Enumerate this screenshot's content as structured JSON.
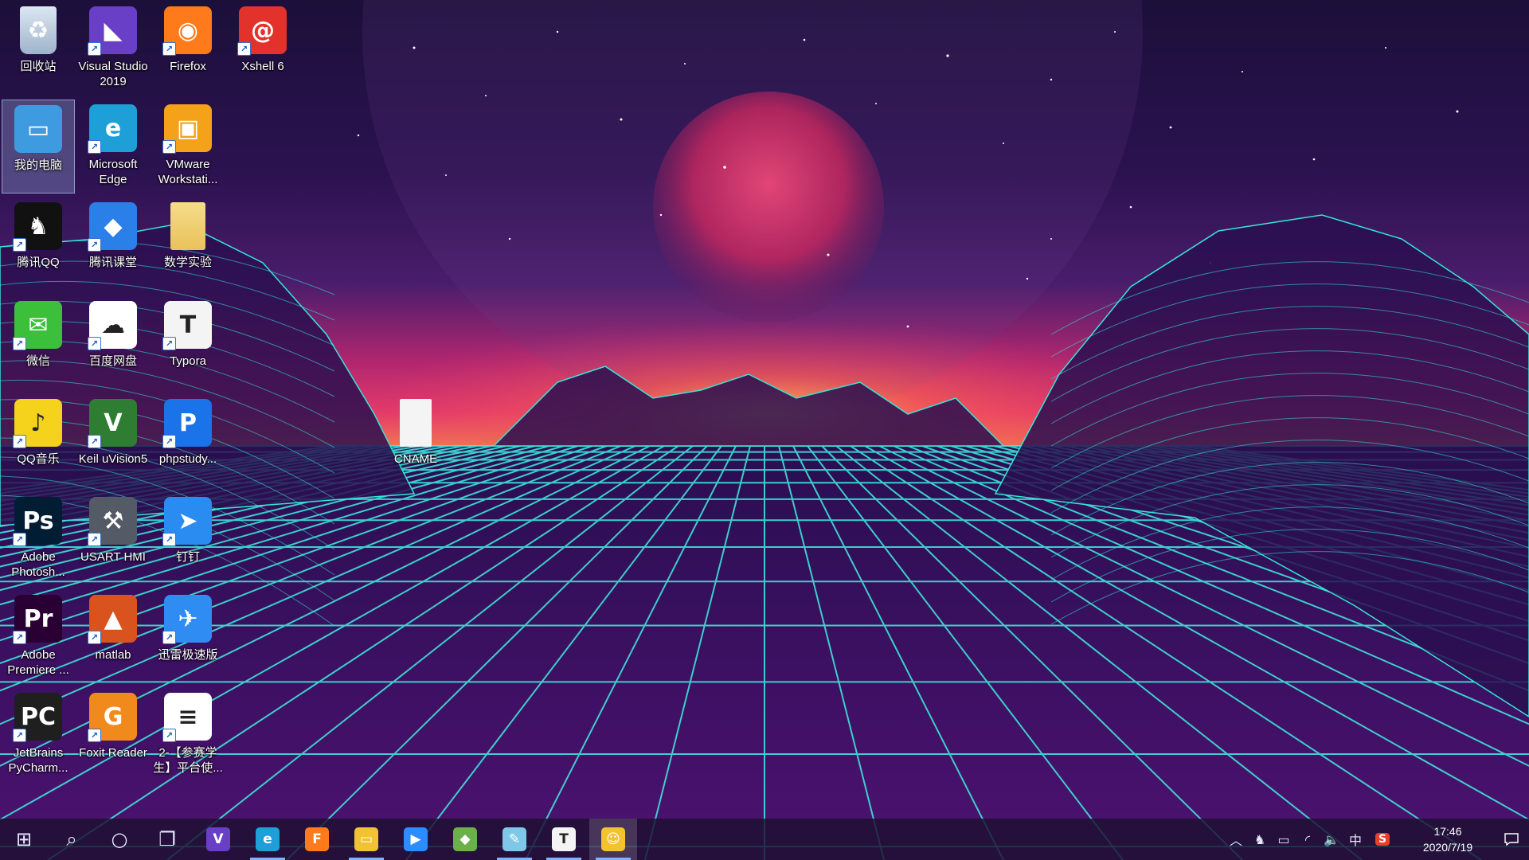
{
  "desktop_icons": [
    {
      "id": "recycle",
      "label": "回收站",
      "icon": "recycle-bin-icon",
      "color": "#8fa8c8",
      "shortcut": false
    },
    {
      "id": "visual_studio",
      "label": "Visual Studio 2019",
      "icon": "visual-studio-icon",
      "color": "#6a3fc8",
      "shortcut": true
    },
    {
      "id": "firefox",
      "label": "Firefox",
      "icon": "firefox-icon",
      "color": "#ff7a1a",
      "shortcut": true
    },
    {
      "id": "xshell",
      "label": "Xshell 6",
      "icon": "xshell-icon",
      "color": "#e2322b",
      "shortcut": true
    },
    {
      "id": "my_computer",
      "label": "我的电脑",
      "icon": "computer-icon",
      "color": "#3f9be0",
      "shortcut": false
    },
    {
      "id": "edge",
      "label": "Microsoft Edge",
      "icon": "edge-icon",
      "color": "#1e9fd8",
      "shortcut": true
    },
    {
      "id": "vmware",
      "label": "VMware Workstati...",
      "icon": "vmware-icon",
      "color": "#f3a21a",
      "shortcut": true
    },
    {
      "id": "qq",
      "label": "腾讯QQ",
      "icon": "qq-penguin-icon",
      "color": "#111111",
      "shortcut": true
    },
    {
      "id": "tencent_class",
      "label": "腾讯课堂",
      "icon": "tencent-classroom-icon",
      "color": "#2b7fe8",
      "shortcut": true
    },
    {
      "id": "math_lab",
      "label": "数学实验",
      "icon": "folder-icon",
      "color": "#f1d27a",
      "shortcut": false
    },
    {
      "id": "wechat",
      "label": "微信",
      "icon": "wechat-icon",
      "color": "#3cc03c",
      "shortcut": true
    },
    {
      "id": "baidu_pan",
      "label": "百度网盘",
      "icon": "baidu-netdisk-icon",
      "color": "#ffffff",
      "shortcut": true
    },
    {
      "id": "typora",
      "label": "Typora",
      "icon": "typora-icon",
      "color": "#f4f4f4",
      "shortcut": true
    },
    {
      "id": "qq_music",
      "label": "QQ音乐",
      "icon": "qq-music-icon",
      "color": "#f5d21c",
      "shortcut": true
    },
    {
      "id": "keil",
      "label": "Keil uVision5",
      "icon": "keil-icon",
      "color": "#2e7d32",
      "shortcut": true
    },
    {
      "id": "phpstudy",
      "label": "phpstudy...",
      "icon": "phpstudy-icon",
      "color": "#1a73e8",
      "shortcut": true
    },
    {
      "id": "cname",
      "label": "CNAME",
      "icon": "file-icon",
      "color": "#ffffff",
      "shortcut": false
    },
    {
      "id": "photoshop",
      "label": "Adobe Photosh...",
      "icon": "photoshop-icon",
      "color": "#001d34",
      "shortcut": true
    },
    {
      "id": "usart_hmi",
      "label": "USART HMI",
      "icon": "usart-hmi-icon",
      "color": "#555b66",
      "shortcut": true
    },
    {
      "id": "dingtalk",
      "label": "钉钉",
      "icon": "dingtalk-icon",
      "color": "#2a8cf0",
      "shortcut": true
    },
    {
      "id": "premiere",
      "label": "Adobe Premiere ...",
      "icon": "premiere-icon",
      "color": "#2a0034",
      "shortcut": true
    },
    {
      "id": "matlab",
      "label": "matlab",
      "icon": "matlab-icon",
      "color": "#d9531e",
      "shortcut": true
    },
    {
      "id": "xunlei",
      "label": "迅雷极速版",
      "icon": "xunlei-icon",
      "color": "#2f8cf2",
      "shortcut": true
    },
    {
      "id": "pycharm",
      "label": "JetBrains PyCharm...",
      "icon": "pycharm-icon",
      "color": "#1f1f1f",
      "shortcut": true
    },
    {
      "id": "foxit",
      "label": "Foxit Reader",
      "icon": "foxit-reader-icon",
      "color": "#f08a1c",
      "shortcut": true
    },
    {
      "id": "doc_2",
      "label": "2-【参赛学生】平台使...",
      "icon": "document-thumbnail-icon",
      "color": "#ffffff",
      "shortcut": true
    }
  ],
  "taskbar": {
    "items": [
      {
        "name": "start-button",
        "icon": "windows-logo-icon",
        "glyph": "⊞",
        "running": false,
        "active": false
      },
      {
        "name": "search-button",
        "icon": "search-icon",
        "glyph": "⌕",
        "running": false,
        "active": false
      },
      {
        "name": "cortana-button",
        "icon": "cortana-circle-icon",
        "glyph": "○",
        "running": false,
        "active": false
      },
      {
        "name": "task-view-button",
        "icon": "task-view-icon",
        "glyph": "❐",
        "running": false,
        "active": false
      },
      {
        "name": "taskbar-visual-studio",
        "icon": "visual-studio-icon",
        "glyph": "V",
        "color": "#6a3fc8",
        "running": false,
        "active": false
      },
      {
        "name": "taskbar-edge",
        "icon": "edge-icon",
        "glyph": "e",
        "color": "#1e9fd8",
        "running": true,
        "active": false
      },
      {
        "name": "taskbar-firefox",
        "icon": "firefox-icon",
        "glyph": "F",
        "color": "#ff7a1a",
        "running": false,
        "active": false
      },
      {
        "name": "taskbar-file-explorer",
        "icon": "folder-icon",
        "glyph": "▭",
        "color": "#f1c232",
        "running": true,
        "active": false
      },
      {
        "name": "taskbar-zoom",
        "icon": "video-camera-icon",
        "glyph": "▶",
        "color": "#2d8cff",
        "running": false,
        "active": false
      },
      {
        "name": "taskbar-git",
        "icon": "git-diamond-icon",
        "glyph": "◆",
        "color": "#6bb04a",
        "running": false,
        "active": false
      },
      {
        "name": "taskbar-notepad",
        "icon": "notepad-icon",
        "glyph": "✎",
        "color": "#7fc7e8",
        "running": true,
        "active": false
      },
      {
        "name": "taskbar-typora",
        "icon": "typora-icon",
        "glyph": "T",
        "color": "#f4f4f4",
        "running": true,
        "active": false
      },
      {
        "name": "taskbar-avatar-app",
        "icon": "avatar-app-icon",
        "glyph": "☺",
        "color": "#f2c230",
        "running": true,
        "active": true
      }
    ],
    "tray": [
      {
        "name": "tray-chevron-up",
        "icon": "chevron-up-icon",
        "glyph": "︿"
      },
      {
        "name": "tray-qq",
        "icon": "qq-penguin-icon",
        "glyph": "♞"
      },
      {
        "name": "tray-battery",
        "icon": "battery-icon",
        "glyph": "▭"
      },
      {
        "name": "tray-wifi",
        "icon": "wifi-icon",
        "glyph": "◜"
      },
      {
        "name": "tray-volume",
        "icon": "volume-icon",
        "glyph": "🔈"
      },
      {
        "name": "tray-ime",
        "icon": "input-method-icon",
        "glyph": "中"
      },
      {
        "name": "tray-sogou",
        "icon": "sogou-ime-icon",
        "glyph": "S"
      }
    ],
    "clock_time": "17:46",
    "clock_date": "2020/7/19"
  }
}
